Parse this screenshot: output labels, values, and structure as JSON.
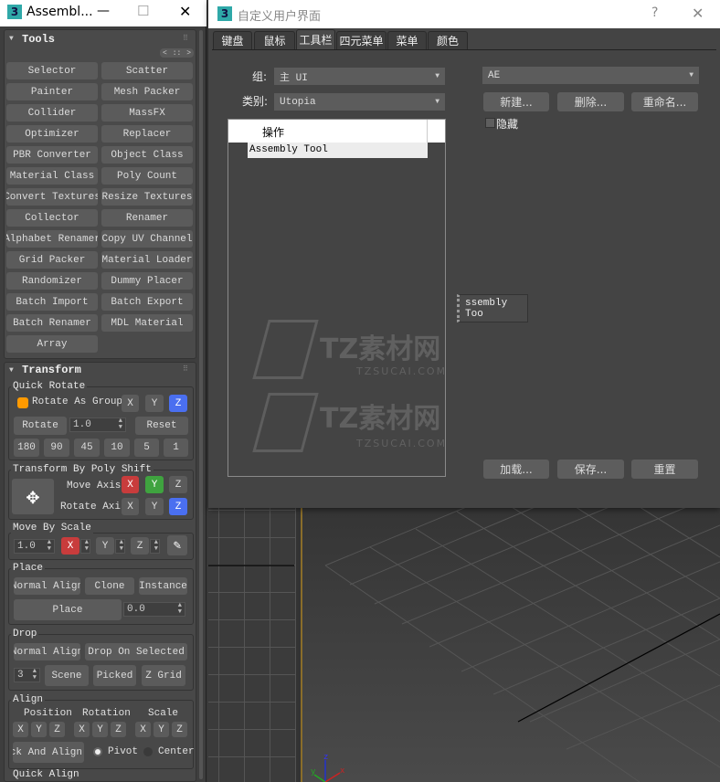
{
  "left_window": {
    "title": "Assembl...",
    "app_icon": "3",
    "minimize": "—",
    "maximize": "☐",
    "close": "✕"
  },
  "tools": {
    "header": "Tools",
    "nav": [
      "<",
      "::",
      ">"
    ],
    "buttons": [
      "Selector",
      "Scatter",
      "Painter",
      "Mesh Packer",
      "Collider",
      "MassFX",
      "Optimizer",
      "Replacer",
      "PBR Converter",
      "Object Class",
      "Material Class",
      "Poly Count",
      "Convert Textures",
      "Resize Textures",
      "Collector",
      "Renamer",
      "Alphabet Renamer",
      "Copy UV Channel",
      "Grid Packer",
      "Material Loader",
      "Randomizer",
      "Dummy Placer",
      "Batch Import",
      "Batch Export",
      "Batch Renamer",
      "MDL Material",
      "Array"
    ]
  },
  "transform": {
    "header": "Transform",
    "quick_rotate": {
      "title": "Quick Rotate",
      "group_label": "Rotate As Group",
      "axes": [
        "X",
        "Y",
        "Z"
      ],
      "rotate": "Rotate",
      "value": "1.0",
      "reset": "Reset",
      "angles": [
        "180",
        "90",
        "45",
        "10",
        "5",
        "1"
      ]
    },
    "poly_shift": {
      "title": "Transform By Poly Shift",
      "move_axis": "Move Axis:",
      "rotate_axis": "Rotate Axis",
      "axes": [
        "X",
        "Y",
        "Z"
      ]
    },
    "move_by_scale": {
      "title": "Move By Scale",
      "value": "1.0",
      "axes": [
        "X",
        "Y",
        "Z"
      ]
    },
    "place": {
      "title": "Place",
      "normal_align": "Normal Align",
      "clone": "Clone",
      "instance": "Instance",
      "place": "Place",
      "value": "0.0"
    },
    "drop": {
      "title": "Drop",
      "normal_align": "Normal Align",
      "drop_on_selected": "Drop On Selected",
      "value": "3",
      "scene": "Scene",
      "picked": "Picked",
      "z_grid": "Z Grid"
    },
    "align": {
      "title": "Align",
      "position": "Position",
      "rotation": "Rotation",
      "scale": "Scale",
      "axes": [
        "X",
        "Y",
        "Z"
      ],
      "pick_and_align": "Pick And Align",
      "pivot": "Pivot",
      "center": "Center"
    },
    "quick_align": {
      "title": "Quick Align"
    }
  },
  "dialog": {
    "title": "自定义用户界面",
    "app_icon": "3",
    "help": "?",
    "close": "✕",
    "tabs": [
      "键盘",
      "鼠标",
      "工具栏",
      "四元菜单",
      "菜单",
      "颜色"
    ],
    "active_tab": "工具栏",
    "group_label": "组:",
    "group_value": "主 UI",
    "category_label": "类别:",
    "category_value": "Utopia",
    "list_header": "操作",
    "list_items": [
      "Assembly Tool"
    ],
    "toolbar_select": "AE",
    "new": "新建...",
    "delete": "删除...",
    "rename": "重命名...",
    "hide": "隐藏",
    "load": "加载...",
    "save": "保存...",
    "reset": "重置"
  },
  "drag_button": "ssembly Too",
  "watermark": {
    "brand": "TZ素材网",
    "url": "TZSUCAI.COM"
  },
  "viewport": {
    "axis_x": "x",
    "axis_y": "y",
    "axis_z": "z"
  },
  "colors": {
    "accent_orange": "#ff9a00",
    "axis_red": "#c83c3c",
    "axis_green": "#3fa33f",
    "axis_blue": "#4a6ff0"
  }
}
